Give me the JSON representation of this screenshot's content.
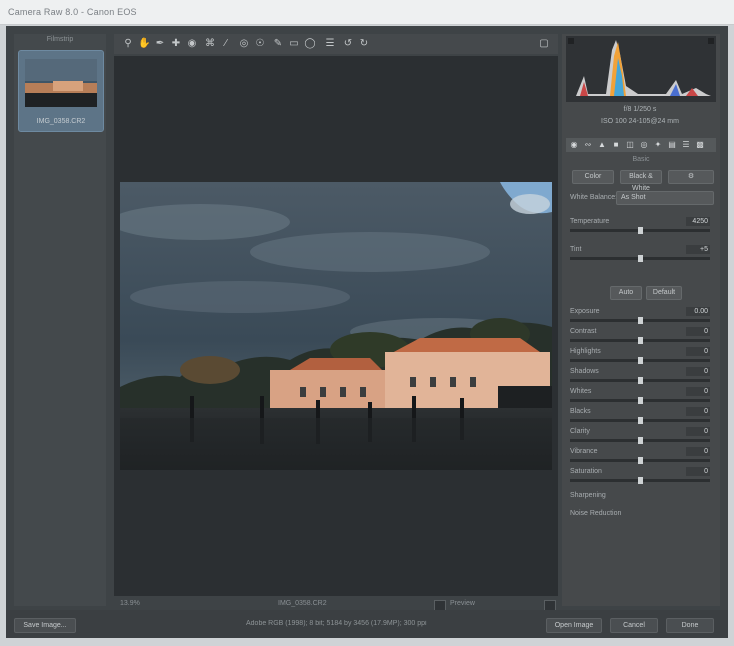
{
  "window": {
    "title": "Camera Raw 8.0 - Canon EOS"
  },
  "filmstrip": {
    "header": "Filmstrip",
    "thumbnail_caption": "IMG_0358.CR2"
  },
  "toolbar": {
    "tool_icons": [
      "zoom-tool-icon",
      "hand-tool-icon",
      "white-balance-tool-icon",
      "color-sampler-icon",
      "targeted-adjustment-icon",
      "crop-tool-icon",
      "straighten-tool-icon",
      "spot-removal-icon",
      "red-eye-icon",
      "adjustment-brush-icon",
      "graduated-filter-icon",
      "radial-filter-icon",
      "preferences-icon",
      "rotate-ccw-icon",
      "rotate-cw-icon"
    ],
    "preview_label": "Preview"
  },
  "status": {
    "zoom": "13.9%",
    "filename": "IMG_0358.CR2",
    "preview_mode": "Preview"
  },
  "right_panel": {
    "camera_info": {
      "row1": "f/8  1/250 s",
      "row2": "ISO 100  24-105@24 mm"
    },
    "section_title": "Basic",
    "treatment_color": "Color",
    "treatment_bw": "Black & White",
    "white_balance_label": "White Balance:",
    "white_balance_value": "As Shot",
    "sliders": [
      {
        "label": "Temperature",
        "value": "4250"
      },
      {
        "label": "Tint",
        "value": "+5"
      }
    ],
    "auto_label": "Auto",
    "default_label": "Default",
    "adjustments": [
      {
        "label": "Exposure",
        "value": "0.00"
      },
      {
        "label": "Contrast",
        "value": "0"
      },
      {
        "label": "Highlights",
        "value": "0"
      },
      {
        "label": "Shadows",
        "value": "0"
      },
      {
        "label": "Whites",
        "value": "0"
      },
      {
        "label": "Blacks",
        "value": "0"
      },
      {
        "label": "Clarity",
        "value": "0"
      },
      {
        "label": "Vibrance",
        "value": "0"
      },
      {
        "label": "Saturation",
        "value": "0"
      }
    ],
    "extra_rows": [
      {
        "label": "Sharpening",
        "value": ""
      },
      {
        "label": "Noise Reduction",
        "value": ""
      }
    ]
  },
  "footer": {
    "save_label": "Save Image...",
    "workflow_link": "Adobe RGB (1998); 8 bit; 5184 by 3456 (17.9MP); 300 ppi",
    "open_label": "Open Image",
    "cancel_label": "Cancel",
    "done_label": "Done"
  }
}
